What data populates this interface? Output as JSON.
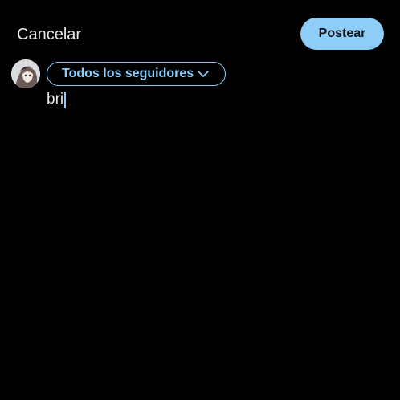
{
  "header": {
    "cancel_label": "Cancelar",
    "post_label": "Postear"
  },
  "composer": {
    "audience_label": "Todos los seguidores",
    "text": "bri"
  },
  "colors": {
    "accent": "#8ecdf8",
    "background": "#000000",
    "text": "#e7e9ea"
  },
  "icons": {
    "audience_chevron": "chevron-down-icon",
    "avatar": "avatar"
  }
}
